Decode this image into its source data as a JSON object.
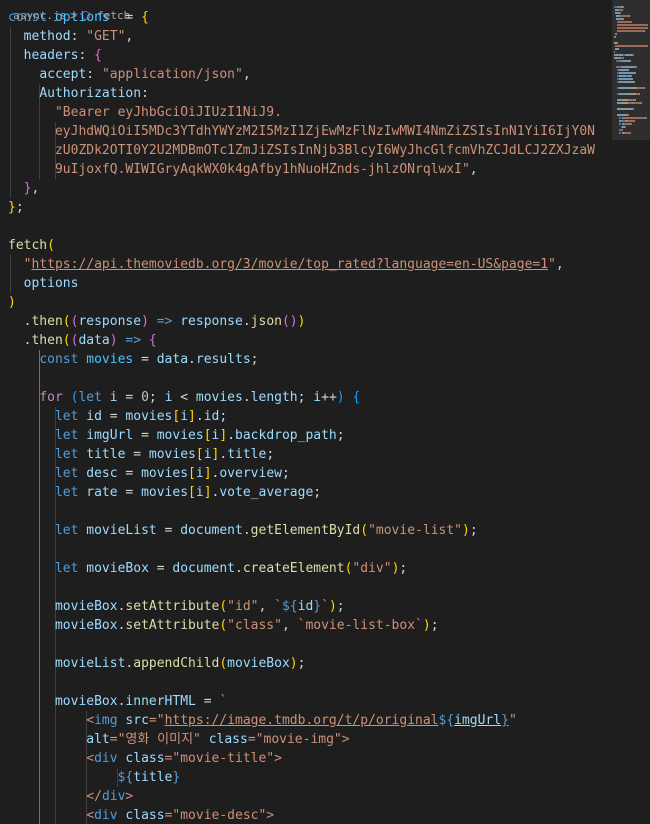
{
  "breadcrumb": {
    "file": "async.js",
    "separator": ">",
    "icon": "function-icon",
    "symbol": "fetch"
  },
  "editor": {
    "language": "javascript",
    "lines": [
      [
        [
          "kw",
          "const "
        ],
        [
          "cst",
          "options"
        ],
        [
          "",
          "  = "
        ],
        [
          "b1",
          "{"
        ]
      ],
      [
        [
          "",
          "  "
        ],
        [
          "var",
          "method"
        ],
        [
          "",
          ": "
        ],
        [
          "str",
          "\"GET\""
        ],
        [
          "",
          ","
        ]
      ],
      [
        [
          "",
          "  "
        ],
        [
          "var",
          "headers"
        ],
        [
          "",
          ": "
        ],
        [
          "b2",
          "{"
        ]
      ],
      [
        [
          "",
          "    "
        ],
        [
          "var",
          "accept"
        ],
        [
          "",
          ": "
        ],
        [
          "str",
          "\"application/json\""
        ],
        [
          "",
          ","
        ]
      ],
      [
        [
          "",
          "    "
        ],
        [
          "var",
          "Authorization"
        ],
        [
          "",
          ":"
        ]
      ],
      [
        [
          "",
          "      "
        ],
        [
          "str",
          "\"Bearer eyJhbGciOiJIUzI1NiJ9."
        ]
      ],
      [
        [
          "",
          "      "
        ],
        [
          "str",
          "eyJhdWQiOiI5MDc3YTdhYWYzM2I5MzI1ZjEwMzFlNzIwMWI4NmZiZSIsInN1YiI6IjY0N"
        ]
      ],
      [
        [
          "",
          "      "
        ],
        [
          "str",
          "zU0ZDk2OTI0Y2U2MDBmOTc1ZmJiZSIsInNjb3BlcyI6WyJhcGlfcmVhZCJdLCJ2ZXJzaW"
        ]
      ],
      [
        [
          "",
          "      "
        ],
        [
          "str",
          "9uIjoxfQ.WIWIGryAqkWX0k4gAfby1hNuoHZnds-jhlzONrqlwxI\""
        ],
        [
          "",
          ","
        ]
      ],
      [
        [
          "",
          "  "
        ],
        [
          "b2",
          "}"
        ],
        [
          "",
          ","
        ]
      ],
      [
        [
          "b1",
          "}"
        ],
        [
          "",
          ";"
        ]
      ],
      [],
      [
        [
          "fn",
          "fetch"
        ],
        [
          "b1",
          "("
        ]
      ],
      [
        [
          "",
          "  "
        ],
        [
          "str",
          "\""
        ],
        [
          "str ul",
          "https://api.themoviedb.org/3/movie/top_rated?language=en-US&page=1"
        ],
        [
          "str",
          "\""
        ],
        [
          "",
          ","
        ]
      ],
      [
        [
          "",
          "  "
        ],
        [
          "var",
          "options"
        ]
      ],
      [
        [
          "b1",
          ")"
        ]
      ],
      [
        [
          "",
          "  ."
        ],
        [
          "fn",
          "then"
        ],
        [
          "b1",
          "("
        ],
        [
          "b2",
          "("
        ],
        [
          "var",
          "response"
        ],
        [
          "b2",
          ")"
        ],
        [
          "kw",
          " =>"
        ],
        [
          "",
          " "
        ],
        [
          "var",
          "response"
        ],
        [
          "",
          "."
        ],
        [
          "fn",
          "json"
        ],
        [
          "b2",
          "()"
        ],
        [
          "b1",
          ")"
        ]
      ],
      [
        [
          "",
          "  ."
        ],
        [
          "fn",
          "then"
        ],
        [
          "b1",
          "("
        ],
        [
          "b2",
          "("
        ],
        [
          "var",
          "data"
        ],
        [
          "b2",
          ")"
        ],
        [
          "kw",
          " =>"
        ],
        [
          "",
          " "
        ],
        [
          "b2",
          "{"
        ]
      ],
      [
        [
          "",
          "    "
        ],
        [
          "kw",
          "const "
        ],
        [
          "cst",
          "movies"
        ],
        [
          "",
          " = "
        ],
        [
          "var",
          "data"
        ],
        [
          "",
          "."
        ],
        [
          "var",
          "results"
        ],
        [
          "",
          ";"
        ]
      ],
      [],
      [
        [
          "",
          "    "
        ],
        [
          "ctl",
          "for"
        ],
        [
          "",
          " "
        ],
        [
          "b3",
          "("
        ],
        [
          "kw",
          "let "
        ],
        [
          "var",
          "i"
        ],
        [
          "",
          " = "
        ],
        [
          "num",
          "0"
        ],
        [
          "",
          "; "
        ],
        [
          "var",
          "i"
        ],
        [
          "",
          " < "
        ],
        [
          "var",
          "movies"
        ],
        [
          "",
          "."
        ],
        [
          "var",
          "length"
        ],
        [
          "",
          "; "
        ],
        [
          "var",
          "i"
        ],
        [
          "",
          "++"
        ],
        [
          "b3",
          ")"
        ],
        [
          "",
          " "
        ],
        [
          "b3",
          "{"
        ]
      ],
      [
        [
          "",
          "      "
        ],
        [
          "kw",
          "let "
        ],
        [
          "var",
          "id"
        ],
        [
          "",
          " = "
        ],
        [
          "var",
          "movies"
        ],
        [
          "b1",
          "["
        ],
        [
          "var",
          "i"
        ],
        [
          "b1",
          "]"
        ],
        [
          "",
          "."
        ],
        [
          "var",
          "id"
        ],
        [
          "",
          ";"
        ]
      ],
      [
        [
          "",
          "      "
        ],
        [
          "kw",
          "let "
        ],
        [
          "var",
          "imgUrl"
        ],
        [
          "",
          " = "
        ],
        [
          "var",
          "movies"
        ],
        [
          "b1",
          "["
        ],
        [
          "var",
          "i"
        ],
        [
          "b1",
          "]"
        ],
        [
          "",
          "."
        ],
        [
          "var",
          "backdrop_path"
        ],
        [
          "",
          ";"
        ]
      ],
      [
        [
          "",
          "      "
        ],
        [
          "kw",
          "let "
        ],
        [
          "var",
          "title"
        ],
        [
          "",
          " = "
        ],
        [
          "var",
          "movies"
        ],
        [
          "b1",
          "["
        ],
        [
          "var",
          "i"
        ],
        [
          "b1",
          "]"
        ],
        [
          "",
          "."
        ],
        [
          "var",
          "title"
        ],
        [
          "",
          ";"
        ]
      ],
      [
        [
          "",
          "      "
        ],
        [
          "kw",
          "let "
        ],
        [
          "var",
          "desc"
        ],
        [
          "",
          " = "
        ],
        [
          "var",
          "movies"
        ],
        [
          "b1",
          "["
        ],
        [
          "var",
          "i"
        ],
        [
          "b1",
          "]"
        ],
        [
          "",
          "."
        ],
        [
          "var",
          "overview"
        ],
        [
          "",
          ";"
        ]
      ],
      [
        [
          "",
          "      "
        ],
        [
          "kw",
          "let "
        ],
        [
          "var",
          "rate"
        ],
        [
          "",
          " = "
        ],
        [
          "var",
          "movies"
        ],
        [
          "b1",
          "["
        ],
        [
          "var",
          "i"
        ],
        [
          "b1",
          "]"
        ],
        [
          "",
          "."
        ],
        [
          "var",
          "vote_average"
        ],
        [
          "",
          ";"
        ]
      ],
      [],
      [
        [
          "",
          "      "
        ],
        [
          "kw",
          "let "
        ],
        [
          "var",
          "movieList"
        ],
        [
          "",
          " = "
        ],
        [
          "var",
          "document"
        ],
        [
          "",
          "."
        ],
        [
          "fn",
          "getElementById"
        ],
        [
          "b1",
          "("
        ],
        [
          "str",
          "\"movie-list\""
        ],
        [
          "b1",
          ")"
        ],
        [
          "",
          ";"
        ]
      ],
      [],
      [
        [
          "",
          "      "
        ],
        [
          "kw",
          "let "
        ],
        [
          "var",
          "movieBox"
        ],
        [
          "",
          " = "
        ],
        [
          "var",
          "document"
        ],
        [
          "",
          "."
        ],
        [
          "fn",
          "createElement"
        ],
        [
          "b1",
          "("
        ],
        [
          "str",
          "\"div\""
        ],
        [
          "b1",
          ")"
        ],
        [
          "",
          ";"
        ]
      ],
      [],
      [
        [
          "",
          "      "
        ],
        [
          "var",
          "movieBox"
        ],
        [
          "",
          "."
        ],
        [
          "fn",
          "setAttribute"
        ],
        [
          "b1",
          "("
        ],
        [
          "str",
          "\"id\""
        ],
        [
          "",
          ", "
        ],
        [
          "str",
          "`"
        ],
        [
          "dol",
          "${"
        ],
        [
          "var",
          "id"
        ],
        [
          "dol",
          "}"
        ],
        [
          "str",
          "`"
        ],
        [
          "b1",
          ")"
        ],
        [
          "",
          ";"
        ]
      ],
      [
        [
          "",
          "      "
        ],
        [
          "var",
          "movieBox"
        ],
        [
          "",
          "."
        ],
        [
          "fn",
          "setAttribute"
        ],
        [
          "b1",
          "("
        ],
        [
          "str",
          "\"class\""
        ],
        [
          "",
          ", "
        ],
        [
          "str",
          "`movie-list-box`"
        ],
        [
          "b1",
          ")"
        ],
        [
          "",
          ";"
        ]
      ],
      [],
      [
        [
          "",
          "      "
        ],
        [
          "var",
          "movieList"
        ],
        [
          "",
          "."
        ],
        [
          "fn",
          "appendChild"
        ],
        [
          "b1",
          "("
        ],
        [
          "var",
          "movieBox"
        ],
        [
          "b1",
          ")"
        ],
        [
          "",
          ";"
        ]
      ],
      [],
      [
        [
          "",
          "      "
        ],
        [
          "var",
          "movieBox"
        ],
        [
          "",
          "."
        ],
        [
          "var",
          "innerHTML"
        ],
        [
          "",
          " = "
        ],
        [
          "str",
          "`"
        ]
      ],
      [
        [
          "",
          "          "
        ],
        [
          "str",
          "<"
        ],
        [
          "tag",
          "img"
        ],
        [
          "str",
          " "
        ],
        [
          "attr",
          "src"
        ],
        [
          "str",
          "=\""
        ],
        [
          "str ul",
          "https://image.tmdb.org/t/p/original"
        ],
        [
          "dol",
          "${"
        ],
        [
          "var ul",
          "imgUrl"
        ],
        [
          "dol ul",
          "}"
        ],
        [
          "str",
          "\""
        ]
      ],
      [
        [
          "",
          "          "
        ],
        [
          "attr",
          "alt"
        ],
        [
          "str",
          "=\"영화 이미지\" "
        ],
        [
          "attr",
          "class"
        ],
        [
          "str",
          "=\"movie-img\">"
        ]
      ],
      [
        [
          "",
          "          "
        ],
        [
          "str",
          "<"
        ],
        [
          "tag",
          "div"
        ],
        [
          "str",
          " "
        ],
        [
          "attr",
          "class"
        ],
        [
          "str",
          "=\"movie-title\">"
        ]
      ],
      [
        [
          "",
          "              "
        ],
        [
          "dol",
          "${"
        ],
        [
          "var",
          "title"
        ],
        [
          "dol",
          "}"
        ]
      ],
      [
        [
          "",
          "          "
        ],
        [
          "str",
          "</"
        ],
        [
          "tag",
          "div"
        ],
        [
          "str",
          ">"
        ]
      ],
      [
        [
          "",
          "          "
        ],
        [
          "str",
          "<"
        ],
        [
          "tag",
          "div"
        ],
        [
          "str",
          " "
        ],
        [
          "attr",
          "class"
        ],
        [
          "str",
          "=\"movie-desc\">"
        ]
      ]
    ]
  },
  "minimap": {
    "label": "minimap"
  }
}
